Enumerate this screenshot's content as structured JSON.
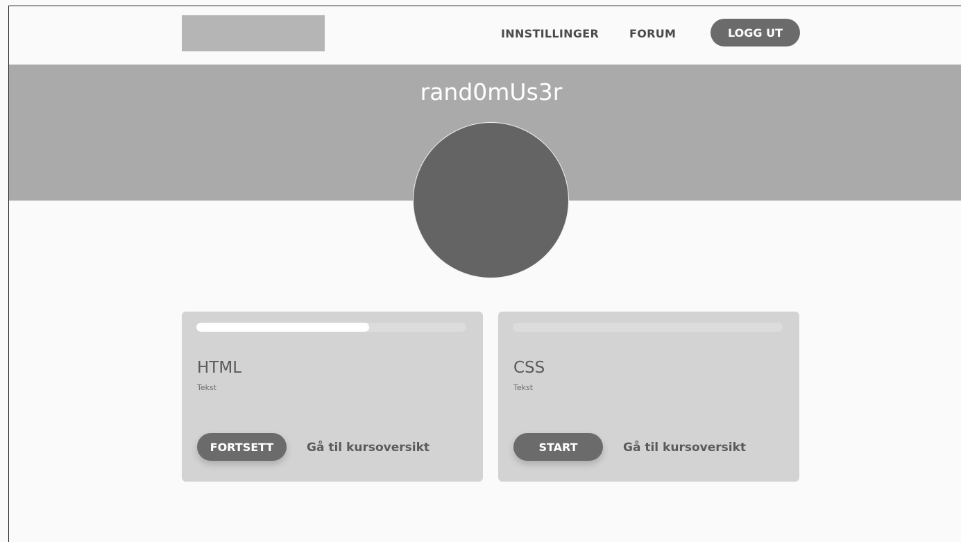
{
  "header": {
    "nav": {
      "settings_label": "INNSTILLINGER",
      "forum_label": "FORUM",
      "logout_label": "LOGG UT"
    }
  },
  "profile": {
    "username": "rand0mUs3r"
  },
  "courses": [
    {
      "title": "HTML",
      "description": "Tekst",
      "progress": 0.64,
      "button_label": "FORTSETT",
      "link_label": "Gå til kursoversikt"
    },
    {
      "title": "CSS",
      "description": "Tekst",
      "progress": 0,
      "button_label": "START",
      "link_label": "Gå til kursoversikt"
    }
  ],
  "colors": {
    "banner": "#aaaaaa",
    "avatar": "#646464",
    "button": "#6b6b6b",
    "card": "#d3d3d3",
    "progress_fill": "#ffffff"
  }
}
